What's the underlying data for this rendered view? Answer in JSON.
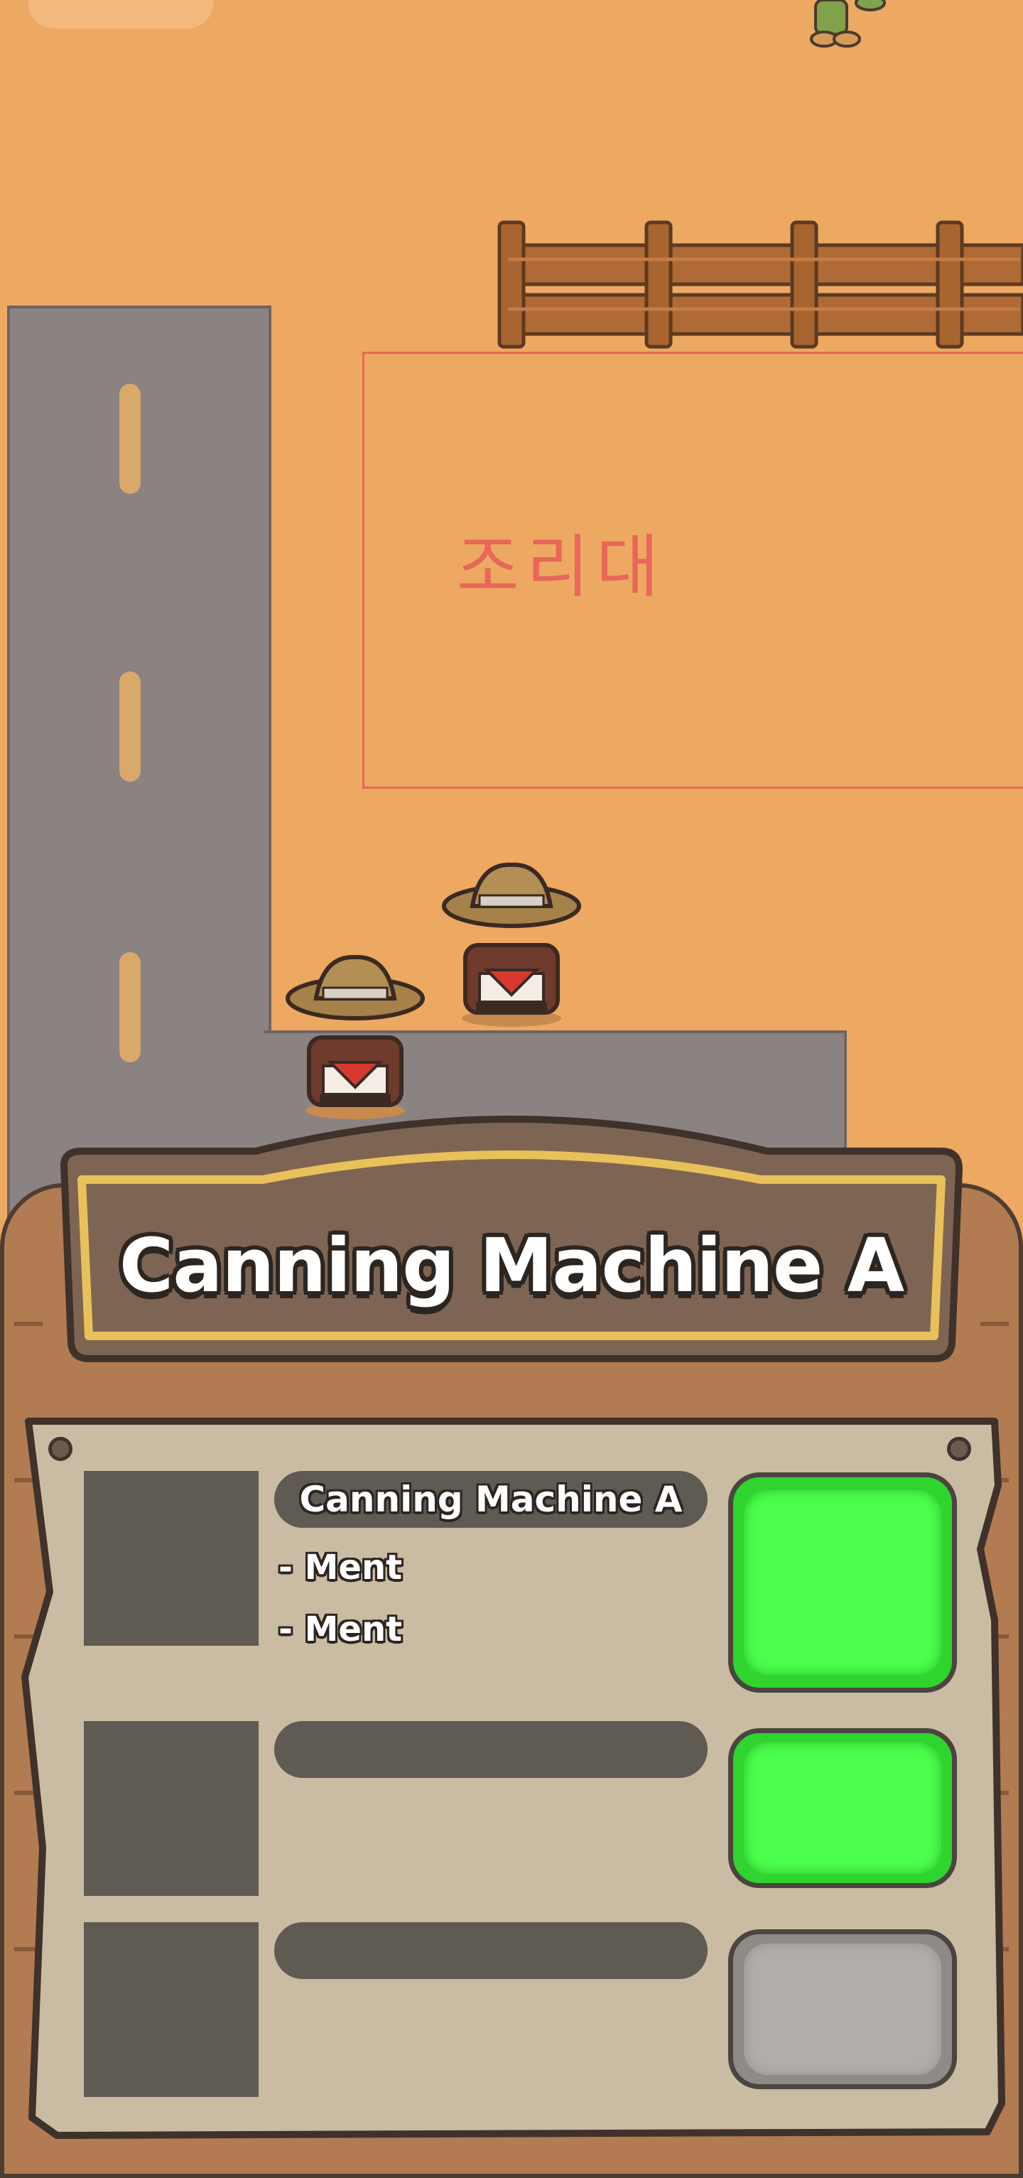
{
  "world": {
    "zone_label": "조리대"
  },
  "panel": {
    "title": "Canning Machine A",
    "rows": [
      {
        "name": "Canning Machine A",
        "lines": [
          "- Ment",
          "- Ment"
        ],
        "button_state": "active"
      },
      {
        "name": "",
        "lines": [],
        "button_state": "active"
      },
      {
        "name": "",
        "lines": [],
        "button_state": "disabled"
      }
    ]
  },
  "colors": {
    "ground": "#EDA862",
    "road": "#8B8282",
    "zone_outline": "#E8665A",
    "board_wood": "#B27B52",
    "banner_brown": "#7E6553",
    "banner_gold": "#E8C15A",
    "paper": "#CABBA3",
    "button_green": "#4DFF4D",
    "button_gray": "#B3ADAA"
  }
}
